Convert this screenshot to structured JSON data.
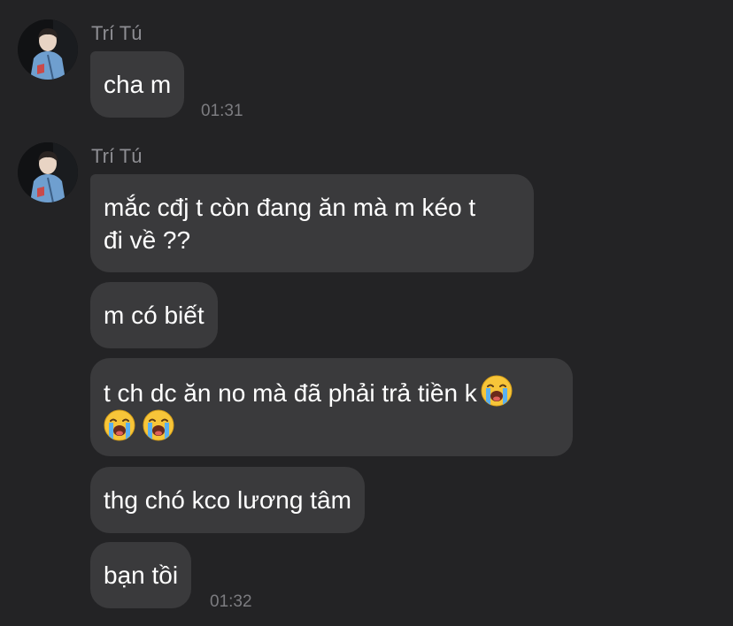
{
  "colors": {
    "background": "#232325",
    "bubble": "#3a3a3c",
    "text": "#ffffff",
    "meta": "#8e8e93"
  },
  "groups": [
    {
      "sender": "Trí Tú",
      "avatar_icon": "user-avatar",
      "messages": [
        {
          "text": "cha m"
        }
      ],
      "time": "01:31"
    },
    {
      "sender": "Trí Tú",
      "avatar_icon": "user-avatar",
      "messages": [
        {
          "line1": "mắc cđj t còn đang ăn mà m kéo t",
          "line2": "đi về ??"
        },
        {
          "text": "m có biết"
        },
        {
          "line1": "t ch dc ăn no mà đã phải trả tiền k",
          "emoji": "loudly-crying-face-emoji",
          "emoji_count": 3
        },
        {
          "text": "thg chó kco lương tâm"
        },
        {
          "text": "bạn tồi"
        }
      ],
      "time": "01:32"
    }
  ]
}
